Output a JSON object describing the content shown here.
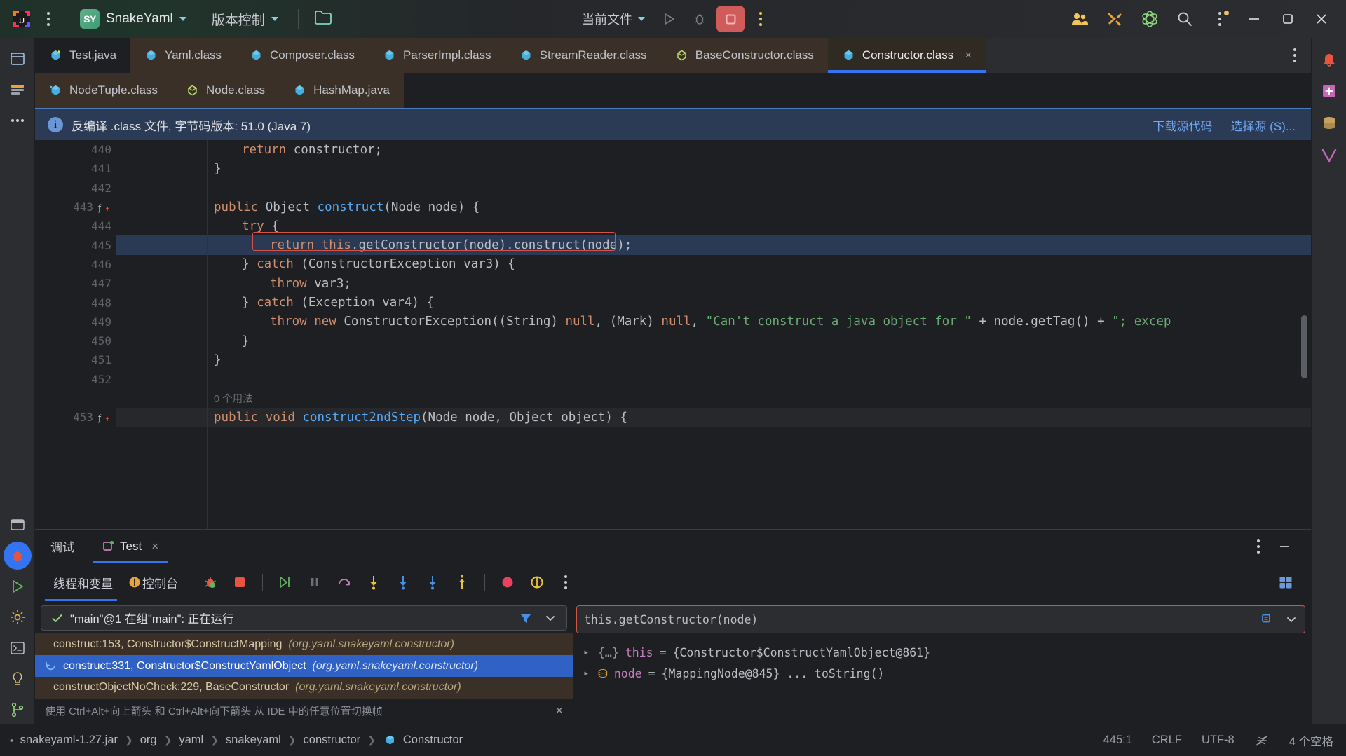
{
  "titlebar": {
    "project_badge": "SY",
    "project_name": "SnakeYaml",
    "vcs_label": "版本控制",
    "run_config": "当前文件",
    "icons": {
      "app_logo": "intellij-idea-logo",
      "main_menu": "main-menu-kebab-icon",
      "folder": "project-folder-icon",
      "run": "run-icon",
      "debug": "debug-icon",
      "stop": "stop-icon",
      "more_run": "more-run-options-icon",
      "collab": "code-with-me-icon",
      "tools": "tools-icon",
      "atom": "ai-assistant-icon",
      "search": "search-everywhere-icon",
      "more": "more-toolbar-icon",
      "minimize": "minimize-window-icon",
      "maximize": "maximize-window-icon",
      "close": "close-window-icon"
    }
  },
  "left_rail": {
    "items": [
      {
        "name": "project-tool-window",
        "icon": "project-icon"
      },
      {
        "name": "commit-tool-window",
        "icon": "commit-icon"
      },
      {
        "name": "more-tool-windows",
        "icon": "ellipsis-icon"
      },
      {
        "name": "terminal-tool-window",
        "icon": "terminal-window-icon"
      },
      {
        "name": "debug-tool-window",
        "icon": "debug-bug-icon"
      },
      {
        "name": "run-tool-window",
        "icon": "run-play-icon"
      },
      {
        "name": "settings-tool-window",
        "icon": "gear-icon"
      },
      {
        "name": "terminal-bottom",
        "icon": "terminal-icon"
      },
      {
        "name": "problems-tool-window",
        "icon": "bulb-icon"
      },
      {
        "name": "version-control-branch",
        "icon": "branch-icon"
      }
    ]
  },
  "right_rail": {
    "items": [
      {
        "name": "notifications",
        "icon": "bell-icon"
      },
      {
        "name": "plugin-panel",
        "icon": "plus-square-icon"
      },
      {
        "name": "database",
        "icon": "database-icon"
      },
      {
        "name": "maven",
        "icon": "maven-m-icon"
      }
    ]
  },
  "tabs": {
    "row1": [
      {
        "label": "Test.java",
        "icon": "java-file-icon",
        "state": "inactive-dark"
      },
      {
        "label": "Yaml.class",
        "icon": "class-file-icon",
        "state": "inactive"
      },
      {
        "label": "Composer.class",
        "icon": "class-file-icon",
        "state": "inactive"
      },
      {
        "label": "ParserImpl.class",
        "icon": "class-file-icon",
        "state": "inactive"
      },
      {
        "label": "StreamReader.class",
        "icon": "class-file-icon",
        "state": "inactive"
      },
      {
        "label": "BaseConstructor.class",
        "icon": "interface-file-icon",
        "state": "inactive"
      },
      {
        "label": "Constructor.class",
        "icon": "class-file-icon",
        "state": "active",
        "closable": true
      }
    ],
    "row2": [
      {
        "label": "NodeTuple.class",
        "icon": "class-file-icon",
        "state": "inactive"
      },
      {
        "label": "Node.class",
        "icon": "interface-file-icon",
        "state": "inactive"
      },
      {
        "label": "HashMap.java",
        "icon": "java-file-icon",
        "state": "inactive"
      }
    ],
    "close_glyph": "×",
    "more_tabs_icon": "tab-list-kebab-icon"
  },
  "notification": {
    "icon": "info-icon",
    "message": "反编译 .class 文件, 字节码版本: 51.0 (Java 7)",
    "links": [
      "下载源代码",
      "选择源 (S)..."
    ]
  },
  "editor": {
    "lines": [
      {
        "num": "440",
        "indent": 4,
        "segments": [
          {
            "t": "return ",
            "c": "kw"
          },
          {
            "t": "constructor;",
            "c": ""
          }
        ]
      },
      {
        "num": "441",
        "indent": 2,
        "segments": [
          {
            "t": "}",
            "c": ""
          }
        ]
      },
      {
        "num": "442",
        "indent": 0,
        "segments": []
      },
      {
        "num": "443",
        "indent": 2,
        "gutter_icon": "method-override-icon",
        "segments": [
          {
            "t": "public ",
            "c": "kw"
          },
          {
            "t": "Object ",
            "c": "type"
          },
          {
            "t": "construct",
            "c": "fn"
          },
          {
            "t": "(Node node) {",
            "c": ""
          }
        ]
      },
      {
        "num": "444",
        "indent": 3,
        "segments": [
          {
            "t": "try ",
            "c": "kw"
          },
          {
            "t": "{",
            "c": ""
          }
        ]
      },
      {
        "num": "445",
        "indent": 4,
        "highlight": true,
        "boxed": true,
        "segments": [
          {
            "t": "return ",
            "c": "kw"
          },
          {
            "t": "this",
            "c": "kw"
          },
          {
            "t": ".getConstructor(node).construct(node);",
            "c": ""
          }
        ]
      },
      {
        "num": "446",
        "indent": 3,
        "segments": [
          {
            "t": "} ",
            "c": ""
          },
          {
            "t": "catch ",
            "c": "kw"
          },
          {
            "t": "(ConstructorException var3) {",
            "c": ""
          }
        ]
      },
      {
        "num": "447",
        "indent": 4,
        "segments": [
          {
            "t": "throw ",
            "c": "kw"
          },
          {
            "t": "var3;",
            "c": ""
          }
        ]
      },
      {
        "num": "448",
        "indent": 3,
        "segments": [
          {
            "t": "} ",
            "c": ""
          },
          {
            "t": "catch ",
            "c": "kw"
          },
          {
            "t": "(Exception var4) {",
            "c": ""
          }
        ]
      },
      {
        "num": "449",
        "indent": 4,
        "segments": [
          {
            "t": "throw new ",
            "c": "kw"
          },
          {
            "t": "ConstructorException((String) ",
            "c": ""
          },
          {
            "t": "null",
            "c": "kw"
          },
          {
            "t": ", (Mark) ",
            "c": ""
          },
          {
            "t": "null",
            "c": "kw"
          },
          {
            "t": ", ",
            "c": ""
          },
          {
            "t": "\"Can't construct a java object for \"",
            "c": "str"
          },
          {
            "t": " + node.getTag() + ",
            "c": ""
          },
          {
            "t": "\"; excep",
            "c": "str"
          }
        ]
      },
      {
        "num": "450",
        "indent": 3,
        "segments": [
          {
            "t": "}",
            "c": ""
          }
        ]
      },
      {
        "num": "451",
        "indent": 2,
        "segments": [
          {
            "t": "}",
            "c": ""
          }
        ]
      },
      {
        "num": "452",
        "indent": 0,
        "segments": []
      },
      {
        "num": "",
        "indent": 2,
        "usage": "0 个用法"
      },
      {
        "num": "453",
        "indent": 2,
        "gutter_icon": "method-override-icon",
        "segments": [
          {
            "t": "public void ",
            "c": "kw"
          },
          {
            "t": "construct2ndStep",
            "c": "fn"
          },
          {
            "t": "(Node node, Object object) {",
            "c": ""
          }
        ]
      }
    ]
  },
  "debug": {
    "panel_title": "调试",
    "tab": {
      "label": "Test",
      "icon": "run-config-icon",
      "close": "×"
    },
    "more_icon": "debug-more-icon",
    "minimize_icon": "minimize-panel-icon",
    "subtabs": [
      {
        "label": "线程和变量",
        "active": true
      },
      {
        "label": "控制台",
        "active": false,
        "icon": "warning-icon"
      }
    ],
    "toolbar_icons": [
      {
        "name": "rerun-debug-icon"
      },
      {
        "name": "stop-icon"
      },
      {
        "name": "resume-program-icon"
      },
      {
        "name": "pause-program-icon"
      },
      {
        "name": "step-over-icon"
      },
      {
        "name": "step-into-icon"
      },
      {
        "name": "force-step-into-icon"
      },
      {
        "name": "smart-step-into-icon"
      },
      {
        "name": "step-out-icon"
      },
      {
        "name": "mute-breakpoints-icon"
      },
      {
        "name": "view-breakpoints-icon"
      },
      {
        "name": "debug-settings-kebab-icon"
      }
    ],
    "layout_icon": "layout-settings-icon",
    "thread": {
      "text": "\"main\"@1 在组\"main\": 正在运行",
      "check_icon": "check-icon",
      "filter_icon": "filter-icon",
      "dropdown_icon": "chevron-down-icon"
    },
    "frames": [
      {
        "method": "construct:153, Constructor$ConstructMapping",
        "pkg": "(org.yaml.snakeyaml.constructor)",
        "selected": false
      },
      {
        "method": "construct:331, Constructor$ConstructYamlObject",
        "pkg": "(org.yaml.snakeyaml.constructor)",
        "selected": true,
        "icon": "current-frame-icon"
      },
      {
        "method": "constructObjectNoCheck:229, BaseConstructor",
        "pkg": "(org.yaml.snakeyaml.constructor)",
        "selected": false
      }
    ],
    "hint": "使用 Ctrl+Alt+向上箭头 和 Ctrl+Alt+向下箭头 从 IDE 中的任意位置切换帧",
    "hint_close": "×",
    "expression": {
      "value": "this.getConstructor(node)",
      "pin_icon": "pin-icon",
      "chevron_icon": "chevron-down-icon"
    },
    "variables": [
      {
        "arrow": "▸",
        "kind_icon": "object-value-icon",
        "kind_glyph": "{…}",
        "name": "this",
        "eq": "=",
        "value": "{Constructor$ConstructYamlObject@861}"
      },
      {
        "arrow": "▸",
        "kind_icon": "field-value-icon",
        "kind_glyph": "⛁",
        "name": "node",
        "eq": "=",
        "value": "{MappingNode@845} ... toString()"
      }
    ]
  },
  "status": {
    "breadcrumb": [
      {
        "label": "snakeyaml-1.27.jar",
        "icon": "jar-icon"
      },
      {
        "label": "org"
      },
      {
        "label": "yaml"
      },
      {
        "label": "snakeyaml"
      },
      {
        "label": "constructor"
      },
      {
        "label": "Constructor",
        "icon": "class-file-icon"
      }
    ],
    "separator": "❯",
    "right": [
      "445:1",
      "CRLF",
      "UTF-8",
      "4 个空格"
    ],
    "lock_icon": "read-only-icon"
  },
  "colors": {
    "accent_blue": "#3574f0",
    "tab_brown": "#3b3027",
    "notif_bg": "#2b3a55",
    "sel_blue": "#2f62c4",
    "red_box": "#d1534a"
  }
}
